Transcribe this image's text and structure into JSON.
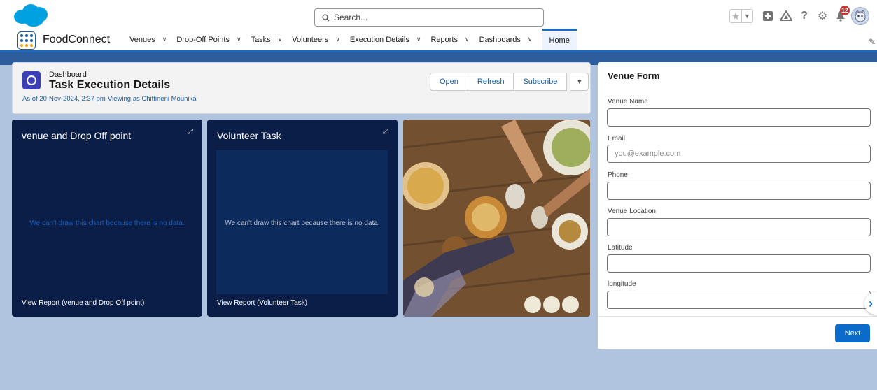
{
  "header": {
    "search_placeholder": "Search...",
    "notification_count": "12"
  },
  "nav": {
    "app_name": "FoodConnect",
    "items": [
      {
        "label": "Venues"
      },
      {
        "label": "Drop-Off Points"
      },
      {
        "label": "Tasks"
      },
      {
        "label": "Volunteers"
      },
      {
        "label": "Execution Details"
      },
      {
        "label": "Reports"
      },
      {
        "label": "Dashboards"
      }
    ],
    "active_item": "Home"
  },
  "dashboard": {
    "type_label": "Dashboard",
    "title": "Task Execution Details",
    "subtitle": "As of 20-Nov-2024, 2:37 pm·Viewing as Chittineni Mounika",
    "buttons": {
      "open": "Open",
      "refresh": "Refresh",
      "subscribe": "Subscribe"
    },
    "cards": [
      {
        "title": "venue and Drop Off point",
        "message": "We can't draw this chart because there is no data.",
        "link": "View Report (venue and Drop Off point)",
        "message_color": "#1f5fb8"
      },
      {
        "title": "Volunteer Task",
        "message": "We can't draw this chart because there is no data.",
        "link": "View Report (Volunteer Task)",
        "message_color": "#b9c4d6"
      }
    ]
  },
  "venue_form": {
    "title": "Venue Form",
    "fields": [
      {
        "label": "Venue Name",
        "value": "",
        "placeholder": ""
      },
      {
        "label": "Email",
        "value": "",
        "placeholder": "you@example.com"
      },
      {
        "label": "Phone",
        "value": "",
        "placeholder": ""
      },
      {
        "label": "Venue Location",
        "value": "",
        "placeholder": ""
      },
      {
        "label": "Latitude",
        "value": "",
        "placeholder": ""
      },
      {
        "label": "longitude",
        "value": "",
        "placeholder": ""
      }
    ],
    "next_label": "Next"
  },
  "colors": {
    "accent": "#0b6bcb",
    "card_bg": "#0a1e47",
    "page_bg": "#b0c4df"
  }
}
